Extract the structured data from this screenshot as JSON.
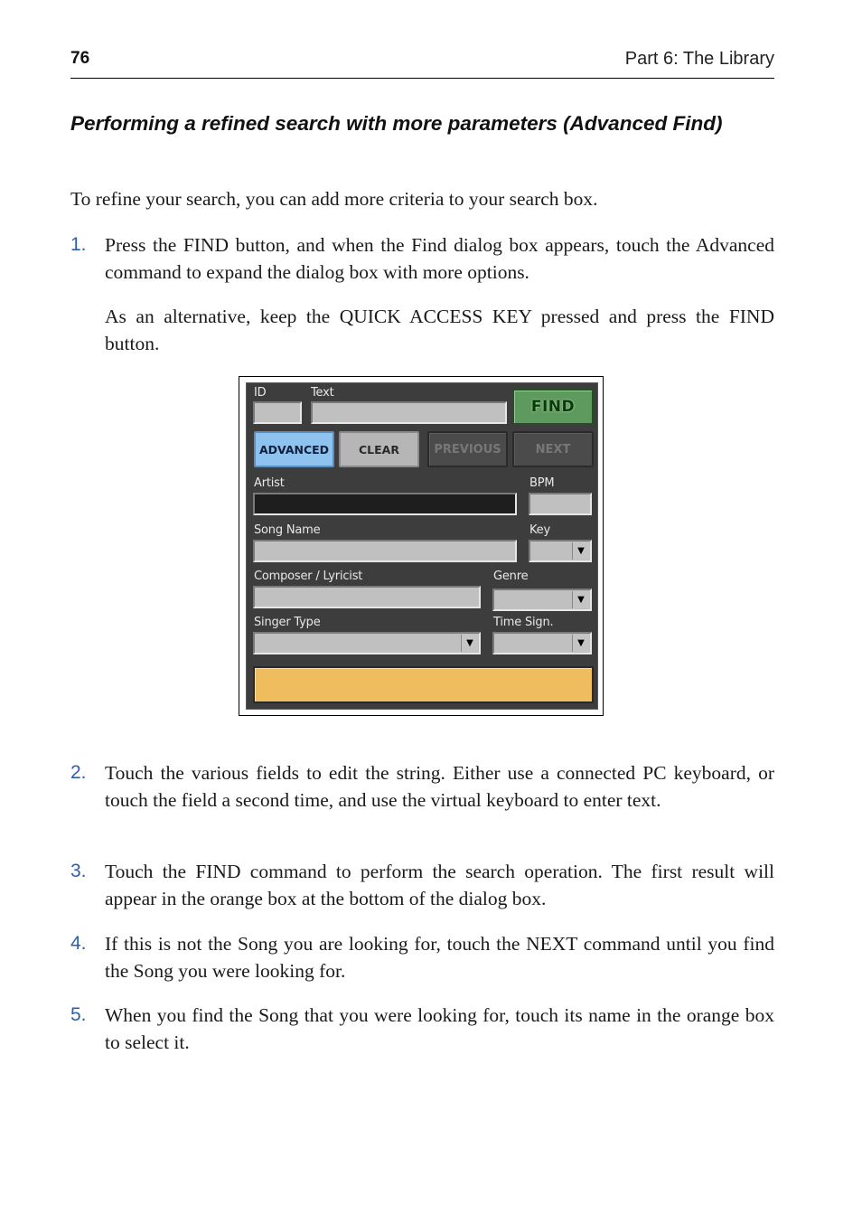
{
  "header": {
    "page_number": "76",
    "running_head": "Part 6: The Library"
  },
  "section": {
    "title": "Performing a refined search with more parameters (Advanced Find)",
    "intro": "To refine your search, you can add more criteria to your search box."
  },
  "steps": [
    {
      "number": "1.",
      "text": "Press the FIND button, and when the Find dialog box appears, touch the Advanced command to expand the dialog box with more options.",
      "note": "As an alternative, keep the QUICK ACCESS KEY pressed and press the FIND button."
    },
    {
      "number": "2.",
      "text": "Touch the various fields to edit the string. Either use a connected PC keyboard, or touch the field a second time, and use the virtual keyboard to enter text."
    },
    {
      "number": "3.",
      "text": "Touch the FIND command to perform the search operation. The first result will appear in the orange box at the bottom of the dialog box."
    },
    {
      "number": "4.",
      "text": "If this is not the Song you are looking for, touch the NEXT command until you find the Song you were looking for."
    },
    {
      "number": "5.",
      "text": "When you find the Song that you were looking for, touch its name in the orange box to select it."
    }
  ],
  "dialog": {
    "labels": {
      "id": "ID",
      "text": "Text",
      "artist": "Artist",
      "bpm": "BPM",
      "song_name": "Song Name",
      "key": "Key",
      "composer": "Composer / Lyricist",
      "genre": "Genre",
      "singer_type": "Singer Type",
      "time_sign": "Time Sign."
    },
    "values": {
      "id": "",
      "text": "",
      "artist": "",
      "bpm": "",
      "song_name": "",
      "key": "",
      "composer": "",
      "genre": "",
      "singer_type": "",
      "time_sign": "",
      "result": ""
    },
    "buttons": {
      "find": "FIND",
      "advanced": "ADVANCED",
      "clear": "CLEAR",
      "previous": "PREVIOUS",
      "next": "NEXT"
    },
    "dropdown_arrow": "▼",
    "colors": {
      "background": "#3d3d3d",
      "find_button": "#5e9a5e",
      "advanced_button": "#8fc3ef",
      "result_box": "#efbd5d"
    }
  }
}
